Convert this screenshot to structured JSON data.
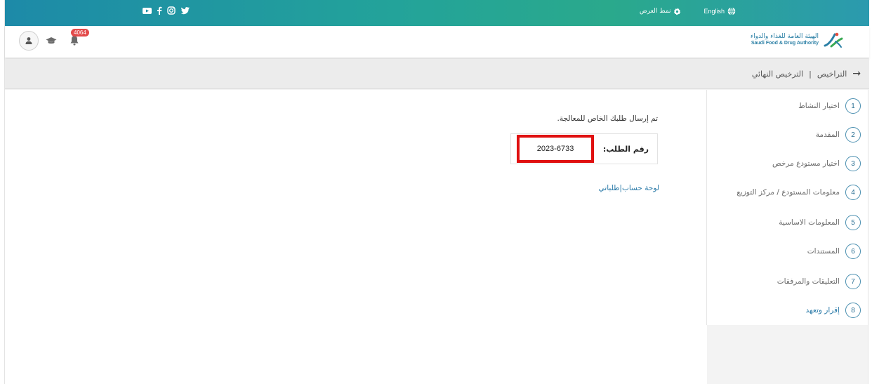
{
  "topbar": {
    "social_icons": [
      "youtube-icon",
      "facebook-icon",
      "instagram-icon",
      "twitter-icon"
    ],
    "display_mode_label": "نمط العرض",
    "language_label": "English"
  },
  "header": {
    "logo_ar": "الهيئة العامة للغذاء والدواء",
    "logo_en": "Saudi Food & Drug Authority",
    "notifications_count": "4064"
  },
  "breadcrumb": {
    "parent": "التراخيص",
    "separator": "|",
    "current": "الترخيص النهائي"
  },
  "steps": [
    {
      "num": "1",
      "label": "اختيار النشاط"
    },
    {
      "num": "2",
      "label": "المقدمة"
    },
    {
      "num": "3",
      "label": "اختيار مستودع مرخص"
    },
    {
      "num": "4",
      "label": "معلومات المستودع / مركز التوزيع"
    },
    {
      "num": "5",
      "label": "المعلومات الاساسية"
    },
    {
      "num": "6",
      "label": "المستندات"
    },
    {
      "num": "7",
      "label": "التعليقات والمرفقات"
    },
    {
      "num": "8",
      "label": "إقرار وتعهد"
    }
  ],
  "main": {
    "message": "تم إرسال طلبك الخاص للمعالجة.",
    "request_label": "رقم الطلب:",
    "request_number": "2023-6733",
    "link_dashboard": "لوحة حساب",
    "link_separator": "|",
    "link_requests": "طلباتي"
  },
  "colors": {
    "topbar_start": "#1d8aa8",
    "topbar_end": "#2b9aae",
    "accent": "#2a7aa8",
    "highlight": "#e01010",
    "badge": "#e34a4a"
  }
}
